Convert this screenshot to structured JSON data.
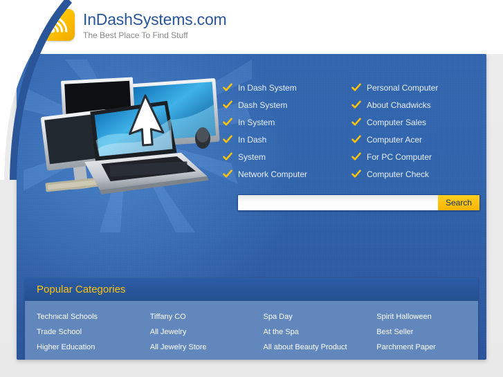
{
  "header": {
    "logo_icon": "wifi-signal-icon",
    "brand_title": "InDashSystems.com",
    "tagline": "The Best Place To Find Stuff"
  },
  "hero": {
    "artwork_icon": "computers-monitors-laptop-cursor-image",
    "links_left": [
      {
        "label": "In Dash System",
        "icon": "check-icon"
      },
      {
        "label": "Dash System",
        "icon": "check-icon"
      },
      {
        "label": "In System",
        "icon": "check-icon"
      },
      {
        "label": "In Dash",
        "icon": "check-icon"
      },
      {
        "label": "System",
        "icon": "check-icon"
      },
      {
        "label": "Network Computer",
        "icon": "check-icon"
      }
    ],
    "links_right": [
      {
        "label": "Personal Computer",
        "icon": "check-icon"
      },
      {
        "label": "About Chadwicks",
        "icon": "check-icon"
      },
      {
        "label": "Computer Sales",
        "icon": "check-icon"
      },
      {
        "label": "Computer Acer",
        "icon": "check-icon"
      },
      {
        "label": "For PC Computer",
        "icon": "check-icon"
      },
      {
        "label": "Computer Check",
        "icon": "check-icon"
      }
    ],
    "search": {
      "value": "",
      "placeholder": "",
      "button_label": "Search"
    }
  },
  "categories": {
    "title": "Popular Categories",
    "items": [
      "Technical Schools",
      "Tiffany CO",
      "Spa Day",
      "Spirit Halloween",
      "Trade School",
      "All Jewelry",
      "At the Spa",
      "Best Seller",
      "Higher Education",
      "All Jewelry Store",
      "All about Beauty Product",
      "Parchment Paper"
    ]
  },
  "colors": {
    "brand_blue": "#2a5699",
    "hero_blue": "#2d62ab",
    "accent_gold": "#ffc20e",
    "category_body": "#6287bd",
    "category_header": "#24508f"
  }
}
